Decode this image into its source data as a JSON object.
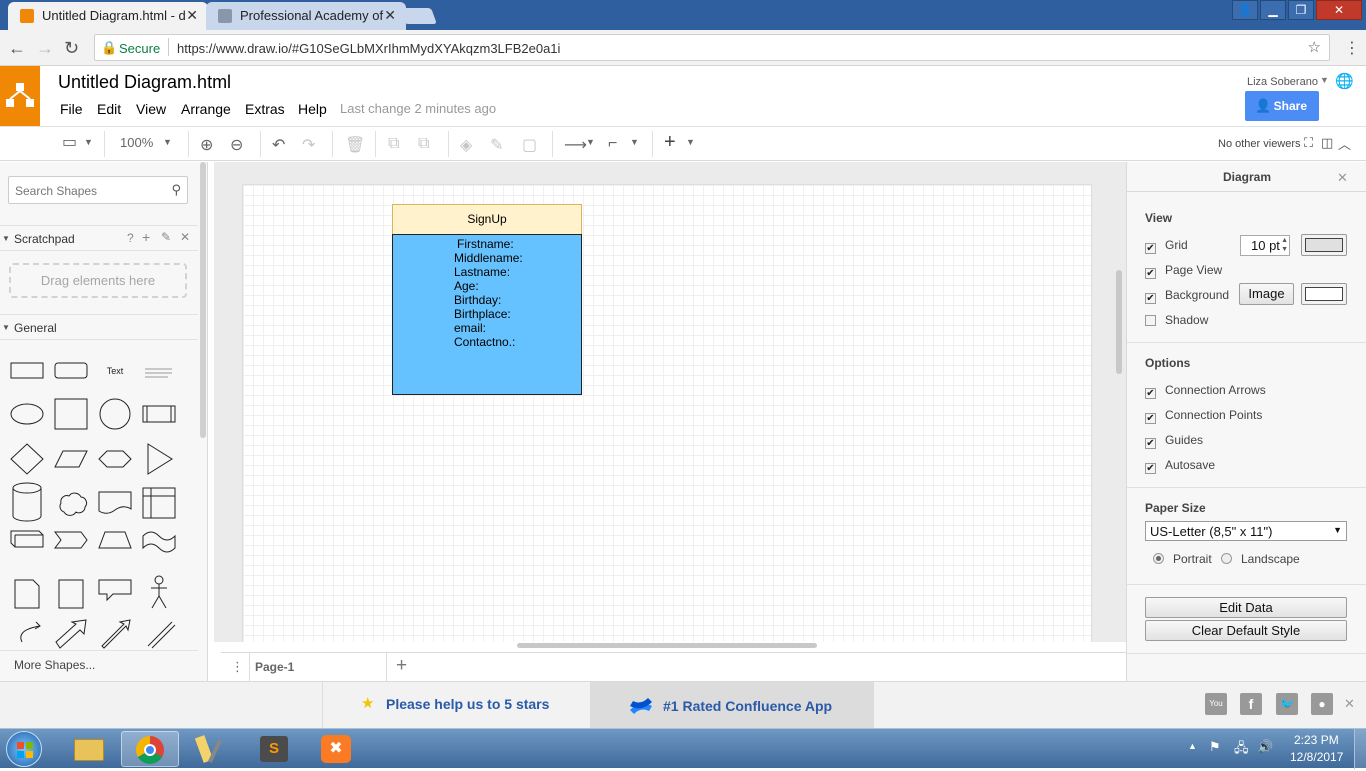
{
  "browser": {
    "tabs": [
      {
        "title": "Untitled Diagram.html - d"
      },
      {
        "title": "Professional Academy of"
      }
    ],
    "secure_label": "Secure",
    "url": "https://www.draw.io/#G10SeGLbMXrIhmMydXYAkqzm3LFB2e0a1i"
  },
  "app": {
    "title": "Untitled Diagram.html",
    "menu": [
      "File",
      "Edit",
      "View",
      "Arrange",
      "Extras",
      "Help"
    ],
    "last_change": "Last change 2 minutes ago",
    "user": "Liza Soberano",
    "share_label": "Share",
    "zoom": "100%",
    "viewers": "No other viewers"
  },
  "left_panel": {
    "search_placeholder": "Search Shapes",
    "scratchpad_label": "Scratchpad",
    "scratchpad_help": "?",
    "drag_hint": "Drag elements here",
    "general_label": "General",
    "text_shape_label": "Text",
    "more_shapes": "More Shapes..."
  },
  "diagram": {
    "header": "SignUp",
    "fields": [
      "Firstname:",
      "Middlename:",
      "Lastname:",
      "Age:",
      "Birthday:",
      "Birthplace:",
      "email:",
      "Contactno.:"
    ],
    "colors": {
      "header_fill": "#fff2cc",
      "body_fill": "#66c2ff"
    }
  },
  "pages": {
    "current": "Page-1"
  },
  "right_panel": {
    "title": "Diagram",
    "view_heading": "View",
    "grid_label": "Grid",
    "grid_size": "10 pt",
    "page_view_label": "Page View",
    "background_label": "Background",
    "image_button": "Image",
    "shadow_label": "Shadow",
    "options_heading": "Options",
    "options": [
      "Connection Arrows",
      "Connection Points",
      "Guides",
      "Autosave"
    ],
    "paper_size_heading": "Paper Size",
    "paper_size_value": "US-Letter (8,5\" x 11\")",
    "portrait_label": "Portrait",
    "landscape_label": "Landscape",
    "edit_data_button": "Edit Data",
    "clear_style_button": "Clear Default Style"
  },
  "adbar": {
    "stars_text": "Please help us to 5 stars",
    "confluence_text": "#1 Rated Confluence App"
  },
  "taskbar": {
    "time": "2:23 PM",
    "date": "12/8/2017"
  }
}
